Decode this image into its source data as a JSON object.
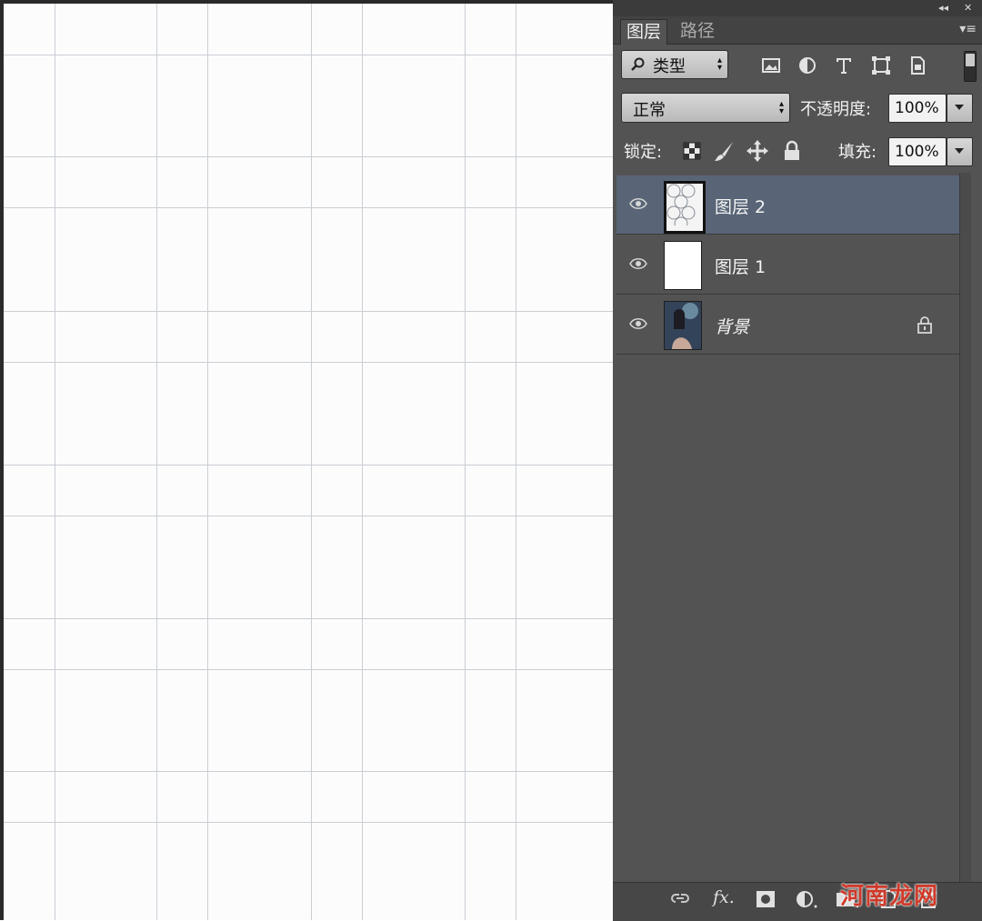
{
  "panel": {
    "tabs": [
      {
        "label": "图层",
        "active": true
      },
      {
        "label": "路径",
        "active": false
      }
    ],
    "collapse_glyph": "◂◂",
    "close_glyph": "✕",
    "menu_glyph": "▾≡",
    "filter": {
      "icon": "search-icon",
      "label": "类型"
    },
    "filter_icons": [
      "image-filter-icon",
      "adjustment-filter-icon",
      "type-filter-icon",
      "shape-filter-icon",
      "smart-object-filter-icon"
    ],
    "blend_mode": "正常",
    "opacity_label": "不透明度:",
    "opacity_value": "100%",
    "lock_label": "锁定:",
    "lock_icons": [
      "lock-transparent-icon",
      "lock-paint-icon",
      "lock-position-icon",
      "lock-all-icon"
    ],
    "fill_label": "填充:",
    "fill_value": "100%",
    "layers": [
      {
        "name": "图层 2",
        "visible": true,
        "selected": true,
        "thumb": "pattern"
      },
      {
        "name": "图层 1",
        "visible": true,
        "selected": false,
        "thumb": "white"
      },
      {
        "name": "背景",
        "visible": true,
        "selected": false,
        "thumb": "photo",
        "locked": true
      }
    ],
    "bottom_icons": [
      "link-icon",
      "fx-icon",
      "mask-icon",
      "adjustment-icon",
      "folder-icon",
      "new-layer-icon",
      "trash-icon"
    ],
    "bottom_fx_label": "fx."
  },
  "watermark": "河南龙网",
  "colors": {
    "panel_bg": "#535353",
    "selected_layer": "#596577",
    "canvas_bg": "#fdfcfd",
    "grid_line": "#c9ced3"
  }
}
